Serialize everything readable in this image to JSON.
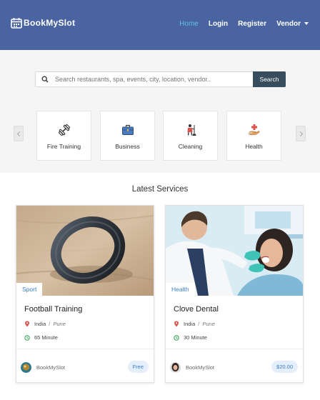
{
  "brand": {
    "name": "BookMySlot",
    "icon": "calendar-icon"
  },
  "nav": {
    "items": [
      {
        "label": "Home",
        "active": true
      },
      {
        "label": "Login",
        "active": false
      },
      {
        "label": "Register",
        "active": false
      },
      {
        "label": "Vendor",
        "active": false,
        "dropdown": true
      }
    ]
  },
  "search": {
    "placeholder": "Search restaurants, spa, events, city, location, vendor..",
    "button_label": "Search",
    "icon": "search-icon"
  },
  "categories": [
    {
      "label": "Fire Training",
      "icon": "dumbbell-icon"
    },
    {
      "label": "Business",
      "icon": "briefcase-icon"
    },
    {
      "label": "Cleaning",
      "icon": "cleaner-icon"
    },
    {
      "label": "Health",
      "icon": "health-hand-icon"
    }
  ],
  "latest": {
    "title": "Latest Services",
    "cards": [
      {
        "badge": "Sport",
        "title": "Football Training",
        "country": "India",
        "separator": "/",
        "city": "Pune",
        "duration": "65 Minute",
        "vendor": "BookMySlot",
        "price": "Free"
      },
      {
        "badge": "Health",
        "title": "Clove Dental",
        "country": "India",
        "separator": "/",
        "city": "Pune",
        "duration": "30 Minute",
        "vendor": "BookMySlot",
        "price": "$20.00"
      }
    ]
  },
  "colors": {
    "header": "#4a64a1",
    "nav_active": "#5bc0eb",
    "search_button": "#374c5d",
    "badge_text": "#3a7dc4",
    "location_pin": "#d9534f",
    "clock": "#2e9e4f"
  }
}
